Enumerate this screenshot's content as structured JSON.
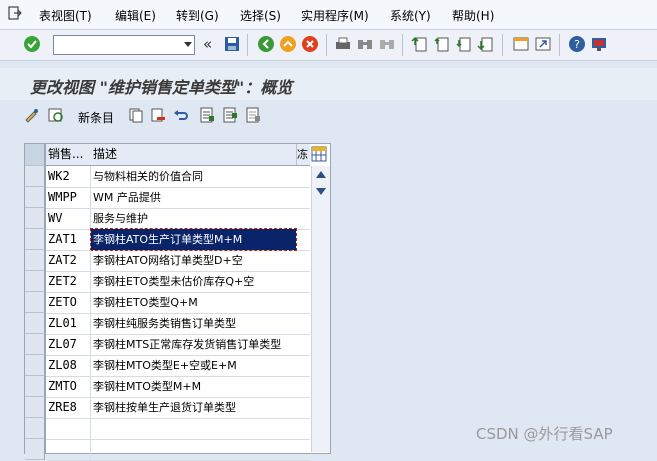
{
  "menubar": {
    "icon": "exit-menu-icon",
    "items": [
      {
        "label": "表视图(T)"
      },
      {
        "label": "编辑(E)"
      },
      {
        "label": "转到(G)"
      },
      {
        "label": "选择(S)"
      },
      {
        "label": "实用程序(M)"
      },
      {
        "label": "系统(Y)"
      },
      {
        "label": "帮助(H)"
      }
    ]
  },
  "toolbar": {
    "command_field_value": "",
    "back_symbol": "«"
  },
  "screen": {
    "title": "更改视图 \"维护销售定单类型\"：概览"
  },
  "application_toolbar": {
    "new_entries_label": "新条目"
  },
  "table": {
    "columns": [
      "销售...",
      "描述"
    ],
    "freeze_label": "冻",
    "rows": [
      {
        "code": "WK2",
        "description": "与物料相关的价值合同"
      },
      {
        "code": "WMPP",
        "description": "WM 产品提供"
      },
      {
        "code": "WV",
        "description": "服务与维护"
      },
      {
        "code": "ZAT1",
        "description": "李钢柱ATO生产订单类型M+M",
        "selected": true
      },
      {
        "code": "ZAT2",
        "description": "李钢柱ATO网络订单类型D+空"
      },
      {
        "code": "ZET2",
        "description": "李钢柱ETO类型未估价库存Q+空"
      },
      {
        "code": "ZETO",
        "description": "李钢柱ETO类型Q+M"
      },
      {
        "code": "ZL01",
        "description": "李钢柱纯服务类销售订单类型"
      },
      {
        "code": "ZL07",
        "description": "李钢柱MTS正常库存发货销售订单类型"
      },
      {
        "code": "ZL08",
        "description": "李钢柱MTO类型E+空或E+M"
      },
      {
        "code": "ZMTO",
        "description": "李钢柱MTO类型M+M"
      },
      {
        "code": "ZRE8",
        "description": "李钢柱按单生产退货订单类型"
      }
    ]
  },
  "watermark": "CSDN @外行看SAP"
}
